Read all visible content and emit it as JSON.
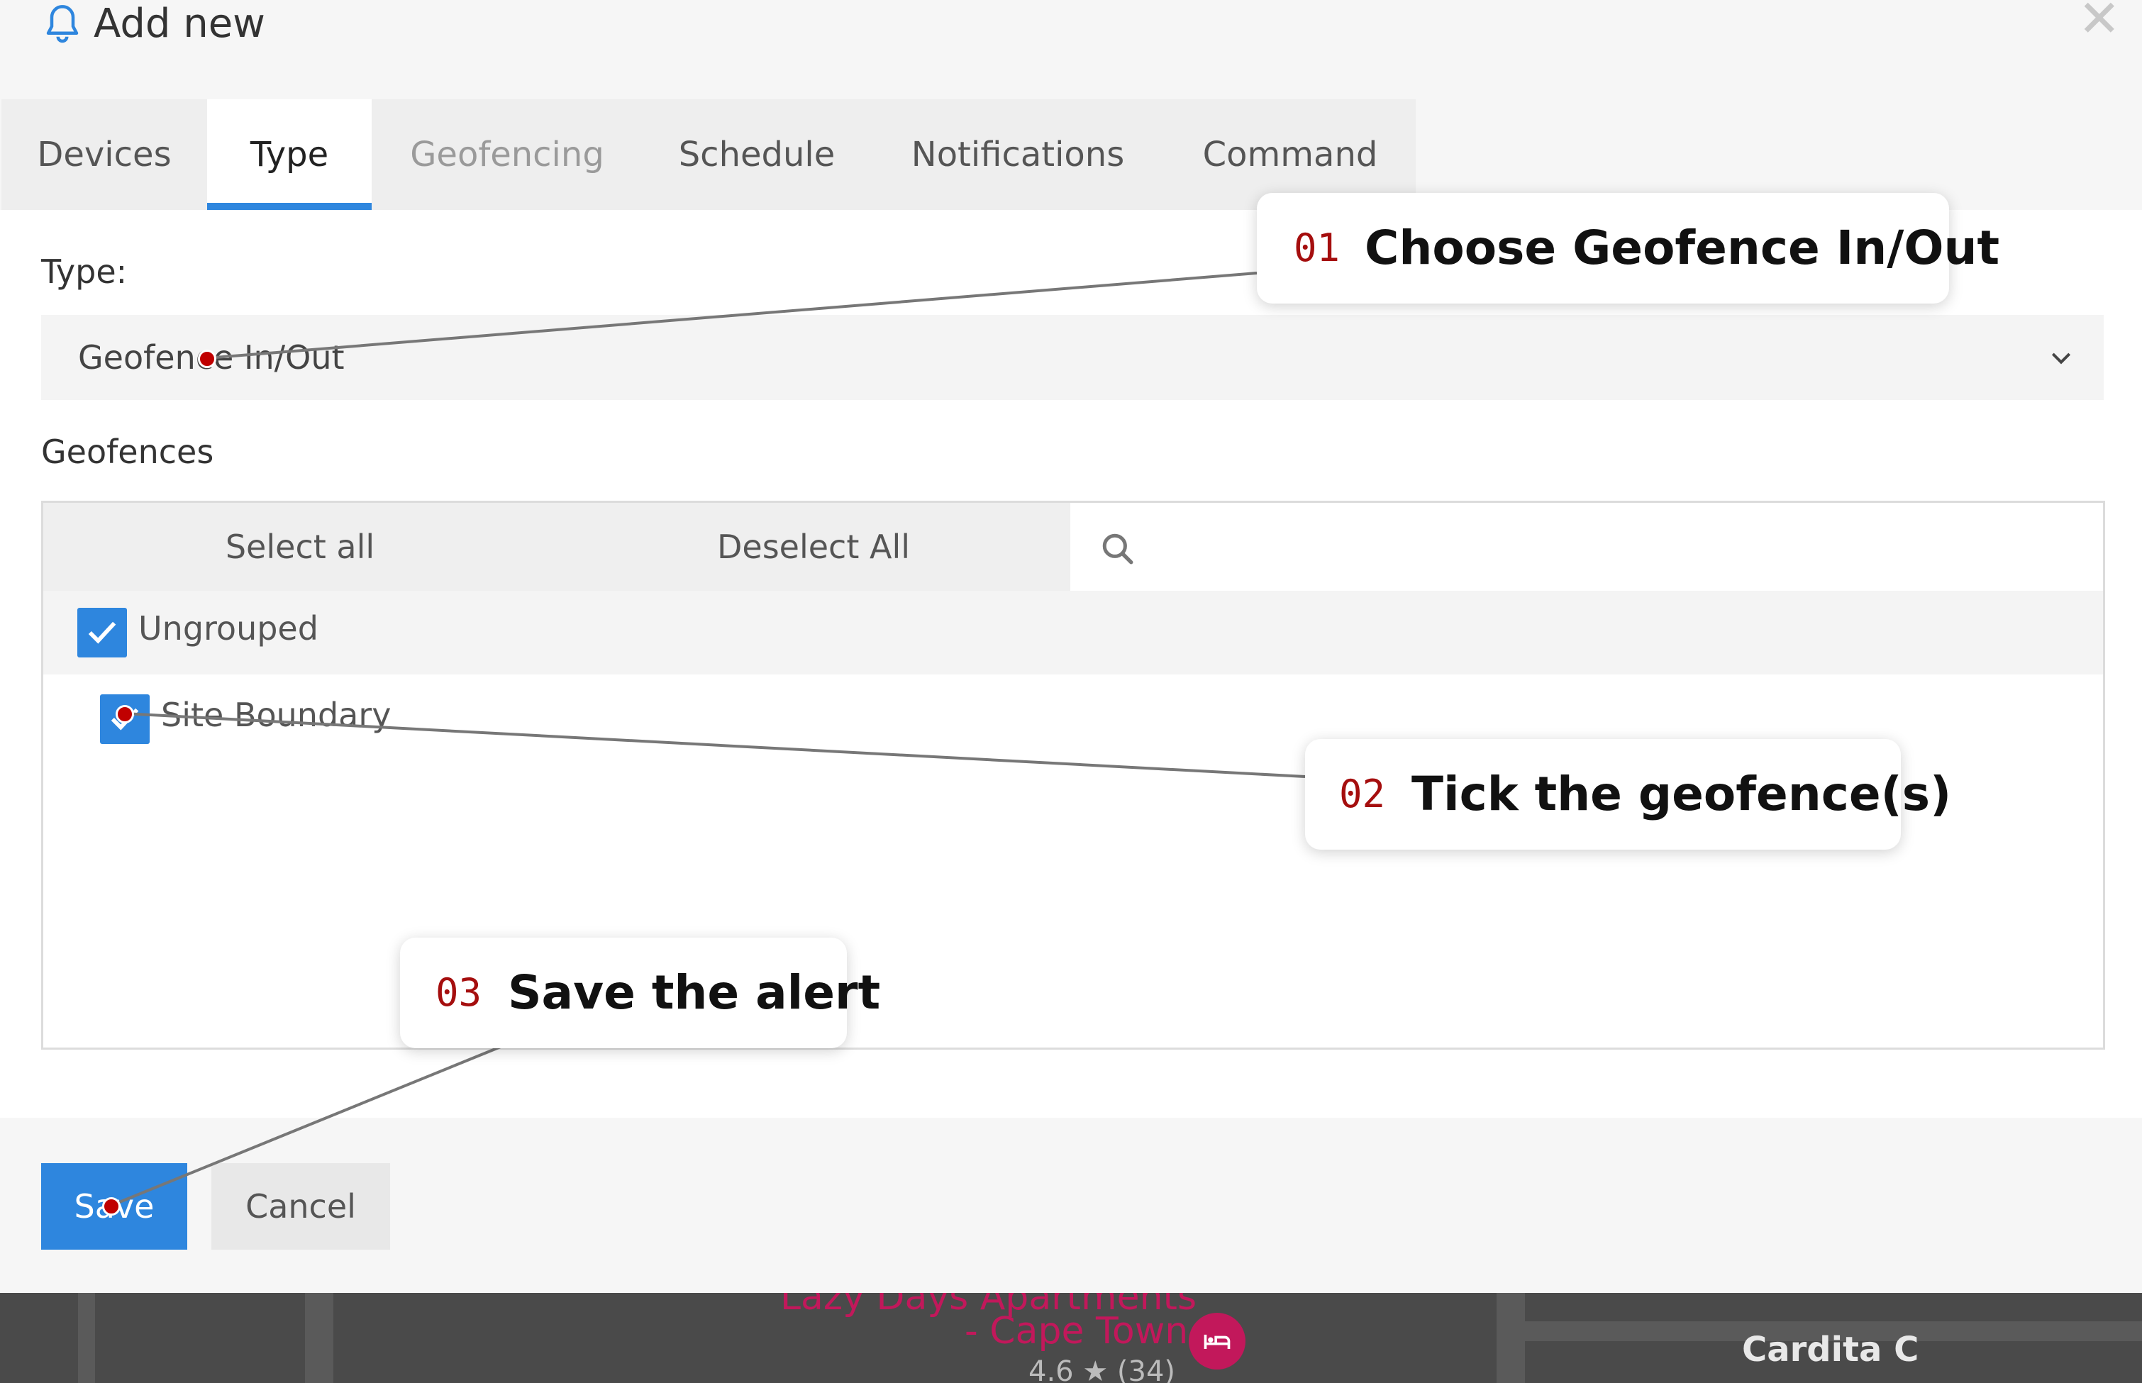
{
  "dialog": {
    "title": "Add new",
    "icon": "bell-icon",
    "close_icon": "close-icon"
  },
  "tabs": [
    {
      "label": "Devices",
      "state": "normal"
    },
    {
      "label": "Type",
      "state": "active"
    },
    {
      "label": "Geofencing",
      "state": "disabled"
    },
    {
      "label": "Schedule",
      "state": "normal"
    },
    {
      "label": "Notifications",
      "state": "normal"
    },
    {
      "label": "Command",
      "state": "normal"
    }
  ],
  "type_field": {
    "label": "Type:",
    "value": "Geofence In/Out"
  },
  "geofences": {
    "label": "Geofences",
    "select_all": "Select all",
    "deselect_all": "Deselect All",
    "search_icon": "search-icon",
    "group": {
      "name": "Ungrouped",
      "checked": true
    },
    "items": [
      {
        "name": "Site Boundary",
        "checked": true
      }
    ]
  },
  "footer": {
    "save": "Save",
    "cancel": "Cancel"
  },
  "callouts": [
    {
      "num": "01",
      "text": "Choose Geofence In/Out"
    },
    {
      "num": "02",
      "text": "Tick the geofence(s)"
    },
    {
      "num": "03",
      "text": "Save the alert"
    }
  ],
  "map": {
    "place_line1": "Lazy Days Apartments",
    "place_line2": "- Cape Town",
    "rating": "4.6 ★ (34)",
    "street": "Cardita C"
  },
  "colors": {
    "accent": "#2e86de",
    "callout_number": "#a50e0e",
    "marker": "#c00000",
    "map_pink": "#c2185b"
  }
}
